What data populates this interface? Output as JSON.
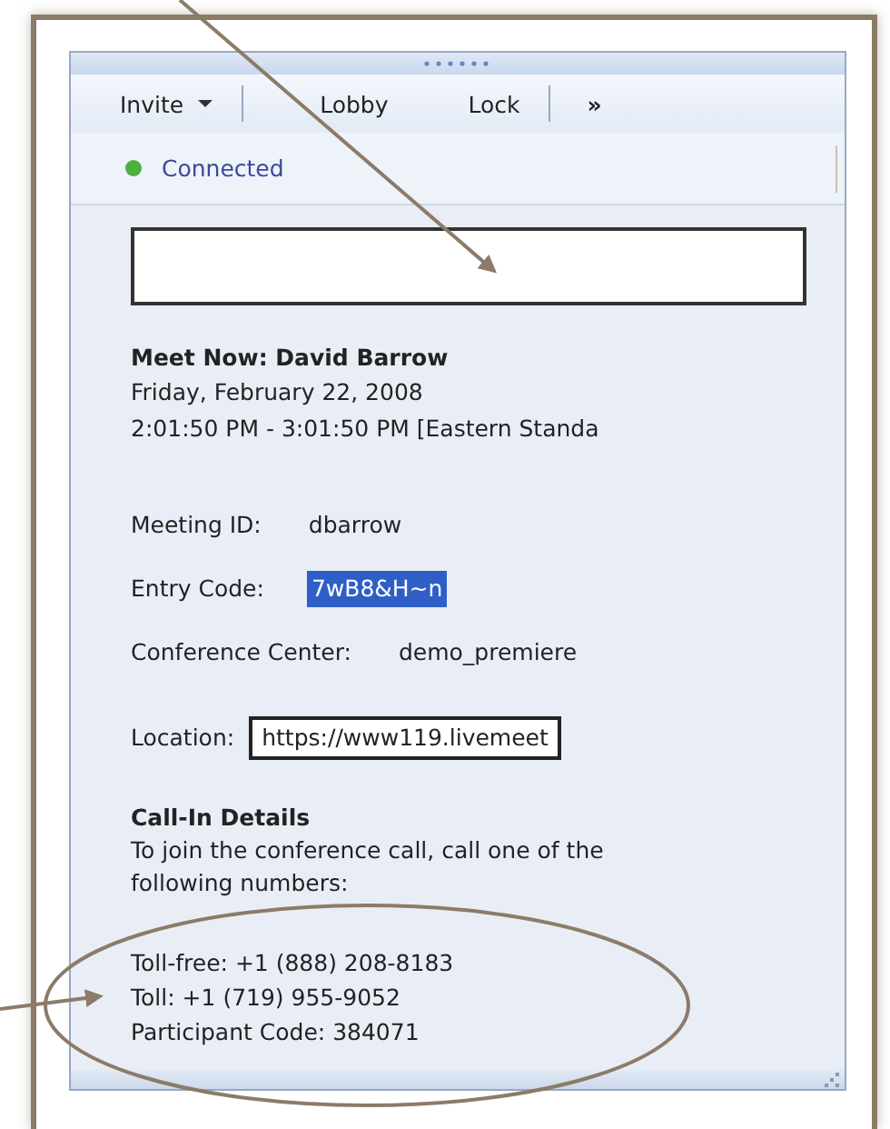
{
  "toolbar": {
    "items": [
      {
        "label": "Invite",
        "kind": "menu"
      },
      {
        "label": "Lobby",
        "kind": "button"
      },
      {
        "label": "Lock",
        "kind": "button"
      },
      {
        "label": "»",
        "kind": "overflow"
      }
    ]
  },
  "status": {
    "label": "Connected",
    "connected": true
  },
  "meeting": {
    "title": "Meet Now: David Barrow",
    "date": "Friday, February 22, 2008",
    "time": "2:01:50 PM - 3:01:50 PM [Eastern Standa"
  },
  "details": [
    {
      "label": "Meeting ID:",
      "value": "dbarrow",
      "kind": "text",
      "selected": false
    },
    {
      "label": "Entry Code:",
      "value": "7wB8&H~n",
      "kind": "text",
      "selected": true
    },
    {
      "label": "Conference Center:",
      "value": "demo_premiere",
      "kind": "text",
      "selected": false
    },
    {
      "label": "Location:",
      "value": "https://www119.livemeet",
      "kind": "field",
      "selected": false
    }
  ],
  "call_in": {
    "heading": "Call-In Details",
    "intro": "To join the conference call, call one of the following numbers:",
    "numbers": [
      "Toll-free: +1 (888) 208-8183",
      "Toll: +1 (719) 955-9052",
      "Participant Code: 384071"
    ]
  }
}
